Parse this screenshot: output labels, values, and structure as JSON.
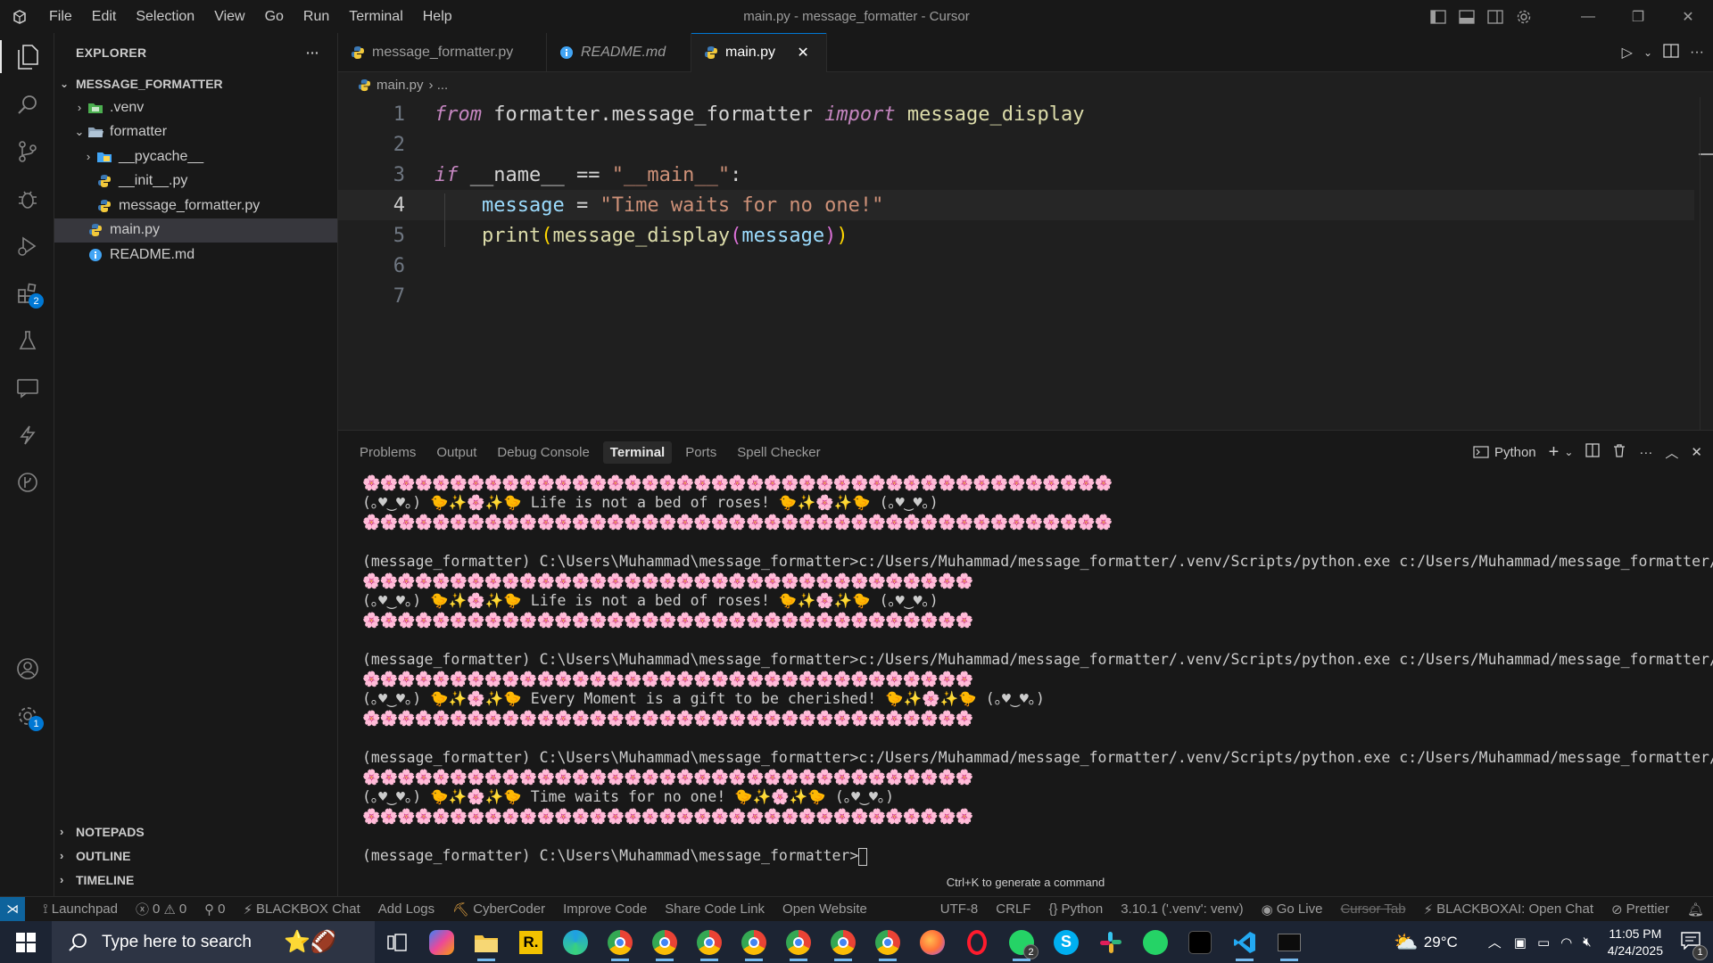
{
  "window": {
    "title": "main.py - message_formatter - Cursor",
    "menu": [
      "File",
      "Edit",
      "Selection",
      "View",
      "Go",
      "Run",
      "Terminal",
      "Help"
    ]
  },
  "activity": {
    "extensions_badge": "2",
    "settings_badge": "1"
  },
  "explorer": {
    "header": "EXPLORER",
    "more": "···",
    "root": "MESSAGE_FORMATTER",
    "items": [
      {
        "label": ".venv",
        "depth": 1,
        "chevron": "›",
        "icon": "folder-venv-icon"
      },
      {
        "label": "formatter",
        "depth": 1,
        "chevron": "⌄",
        "icon": "folder-open-icon"
      },
      {
        "label": "__pycache__",
        "depth": 2,
        "chevron": "›",
        "icon": "folder-pycache-icon"
      },
      {
        "label": "__init__.py",
        "depth": 2,
        "chevron": "",
        "icon": "python-file-icon"
      },
      {
        "label": "message_formatter.py",
        "depth": 2,
        "chevron": "",
        "icon": "python-file-icon"
      },
      {
        "label": "main.py",
        "depth": 1,
        "chevron": "",
        "icon": "python-file-icon",
        "selected": true
      },
      {
        "label": "README.md",
        "depth": 1,
        "chevron": "",
        "icon": "info-file-icon"
      }
    ],
    "sections": [
      "NOTEPADS",
      "OUTLINE",
      "TIMELINE"
    ]
  },
  "tabs": [
    {
      "label": "message_formatter.py",
      "icon": "python-file-icon",
      "active": false,
      "italic": false
    },
    {
      "label": "README.md",
      "icon": "info-file-icon",
      "active": false,
      "italic": true
    },
    {
      "label": "main.py",
      "icon": "python-file-icon",
      "active": true,
      "italic": false
    }
  ],
  "tab_close": "✕",
  "breadcrumb": {
    "file": "main.py",
    "rest": "› ..."
  },
  "editor": {
    "current_line": 4,
    "line_numbers": [
      "1",
      "2",
      "3",
      "4",
      "5",
      "6",
      "7"
    ],
    "line1": {
      "kw1": "from",
      "mod": " formatter.message_formatter ",
      "kw2": "import",
      "name": " message_display"
    },
    "line3": {
      "kw": "if",
      "a": " __name__ == ",
      "str": "\"__main__\"",
      "b": ":"
    },
    "line4": {
      "indent": "    ",
      "var": "message",
      "eq": " = ",
      "str": "\"Time waits for no one!\""
    },
    "line5": {
      "indent": "    ",
      "fn1": "print",
      "p1": "(",
      "fn2": "message_display",
      "p2": "(",
      "var": "message",
      "p3": ")",
      "p4": ")"
    }
  },
  "panel": {
    "tabs": [
      "Problems",
      "Output",
      "Debug Console",
      "Terminal",
      "Ports",
      "Spell Checker"
    ],
    "active_tab": "Terminal",
    "shell": "Python",
    "hint": "Ctrl+K to generate a command"
  },
  "terminal": {
    "lines": [
      {
        "kind": "flowers",
        "text": "🌸🌸🌸🌸🌸🌸🌸🌸🌸🌸🌸🌸🌸🌸🌸🌸🌸🌸🌸🌸🌸🌸🌸🌸🌸🌸🌸🌸🌸🌸🌸🌸🌸🌸🌸🌸🌸🌸🌸🌸🌸🌸🌸"
      },
      {
        "kind": "text",
        "text": "(｡♥‿♥｡) 🐤✨🌸✨🐤 Life is not a bed of roses! 🐤✨🌸✨🐤 (｡♥‿♥｡)"
      },
      {
        "kind": "flowers",
        "text": "🌸🌸🌸🌸🌸🌸🌸🌸🌸🌸🌸🌸🌸🌸🌸🌸🌸🌸🌸🌸🌸🌸🌸🌸🌸🌸🌸🌸🌸🌸🌸🌸🌸🌸🌸🌸🌸🌸🌸🌸🌸🌸🌸"
      },
      {
        "kind": "blank",
        "text": ""
      },
      {
        "kind": "text",
        "text": "(message_formatter) C:\\Users\\Muhammad\\message_formatter>c:/Users/Muhammad/message_formatter/.venv/Scripts/python.exe c:/Users/Muhammad/message_formatter/main.py"
      },
      {
        "kind": "flowers",
        "text": "🌸🌸🌸🌸🌸🌸🌸🌸🌸🌸🌸🌸🌸🌸🌸🌸🌸🌸🌸🌸🌸🌸🌸🌸🌸🌸🌸🌸🌸🌸🌸🌸🌸🌸🌸"
      },
      {
        "kind": "text",
        "text": "(｡♥‿♥｡) 🐤✨🌸✨🐤 Life is not a bed of roses! 🐤✨🌸✨🐤 (｡♥‿♥｡)"
      },
      {
        "kind": "flowers",
        "text": "🌸🌸🌸🌸🌸🌸🌸🌸🌸🌸🌸🌸🌸🌸🌸🌸🌸🌸🌸🌸🌸🌸🌸🌸🌸🌸🌸🌸🌸🌸🌸🌸🌸🌸🌸"
      },
      {
        "kind": "blank",
        "text": ""
      },
      {
        "kind": "text",
        "text": "(message_formatter) C:\\Users\\Muhammad\\message_formatter>c:/Users/Muhammad/message_formatter/.venv/Scripts/python.exe c:/Users/Muhammad/message_formatter/main.py"
      },
      {
        "kind": "flowers",
        "text": "🌸🌸🌸🌸🌸🌸🌸🌸🌸🌸🌸🌸🌸🌸🌸🌸🌸🌸🌸🌸🌸🌸🌸🌸🌸🌸🌸🌸🌸🌸🌸🌸🌸🌸🌸"
      },
      {
        "kind": "text",
        "text": "(｡♥‿♥｡) 🐤✨🌸✨🐤 Every Moment is a gift to be cherished! 🐤✨🌸✨🐤 (｡♥‿♥｡)"
      },
      {
        "kind": "flowers",
        "text": "🌸🌸🌸🌸🌸🌸🌸🌸🌸🌸🌸🌸🌸🌸🌸🌸🌸🌸🌸🌸🌸🌸🌸🌸🌸🌸🌸🌸🌸🌸🌸🌸🌸🌸🌸"
      },
      {
        "kind": "blank",
        "text": ""
      },
      {
        "kind": "text",
        "text": "(message_formatter) C:\\Users\\Muhammad\\message_formatter>c:/Users/Muhammad/message_formatter/.venv/Scripts/python.exe c:/Users/Muhammad/message_formatter/main.py"
      },
      {
        "kind": "flowers",
        "text": "🌸🌸🌸🌸🌸🌸🌸🌸🌸🌸🌸🌸🌸🌸🌸🌸🌸🌸🌸🌸🌸🌸🌸🌸🌸🌸🌸🌸🌸🌸🌸🌸🌸🌸🌸"
      },
      {
        "kind": "text",
        "text": "(｡♥‿♥｡) 🐤✨🌸✨🐤 Time waits for no one! 🐤✨🌸✨🐤 (｡♥‿♥｡)"
      },
      {
        "kind": "flowers",
        "text": "🌸🌸🌸🌸🌸🌸🌸🌸🌸🌸🌸🌸🌸🌸🌸🌸🌸🌸🌸🌸🌸🌸🌸🌸🌸🌸🌸🌸🌸🌸🌸🌸🌸🌸🌸"
      },
      {
        "kind": "blank",
        "text": ""
      },
      {
        "kind": "prompt",
        "text": "(message_formatter) C:\\Users\\Muhammad\\message_formatter>"
      }
    ]
  },
  "statusbar": {
    "launchpad": "Launchpad",
    "errors": "0",
    "warnings": "0",
    "ports": "0",
    "blackbox_chat": "BLACKBOX Chat",
    "add_logs": "Add Logs",
    "cybercoder": "CyberCoder",
    "improve_code": "Improve Code",
    "share_code_link": "Share Code Link",
    "open_website": "Open Website",
    "encoding": "UTF-8",
    "eol": "CRLF",
    "language": "Python",
    "interpreter": "3.10.1 ('.venv': venv)",
    "go_live": "Go Live",
    "cursor_tab": "Cursor Tab",
    "blackbox_open_chat": "BLACKBOXAI: Open Chat",
    "prettier": "Prettier"
  },
  "taskbar": {
    "search_placeholder": "Type here to search",
    "weather": "29°C",
    "time": "11:05 PM",
    "date": "4/24/2025",
    "whatsapp_badge": "2",
    "notification_badge": "1",
    "colors": {
      "chrome": "#4285f4",
      "edge": "#1fa0e3",
      "firefox": "#ff7139",
      "whatsapp": "#25d366",
      "skype": "#00aff0",
      "vscode": "#23a9f2"
    }
  }
}
